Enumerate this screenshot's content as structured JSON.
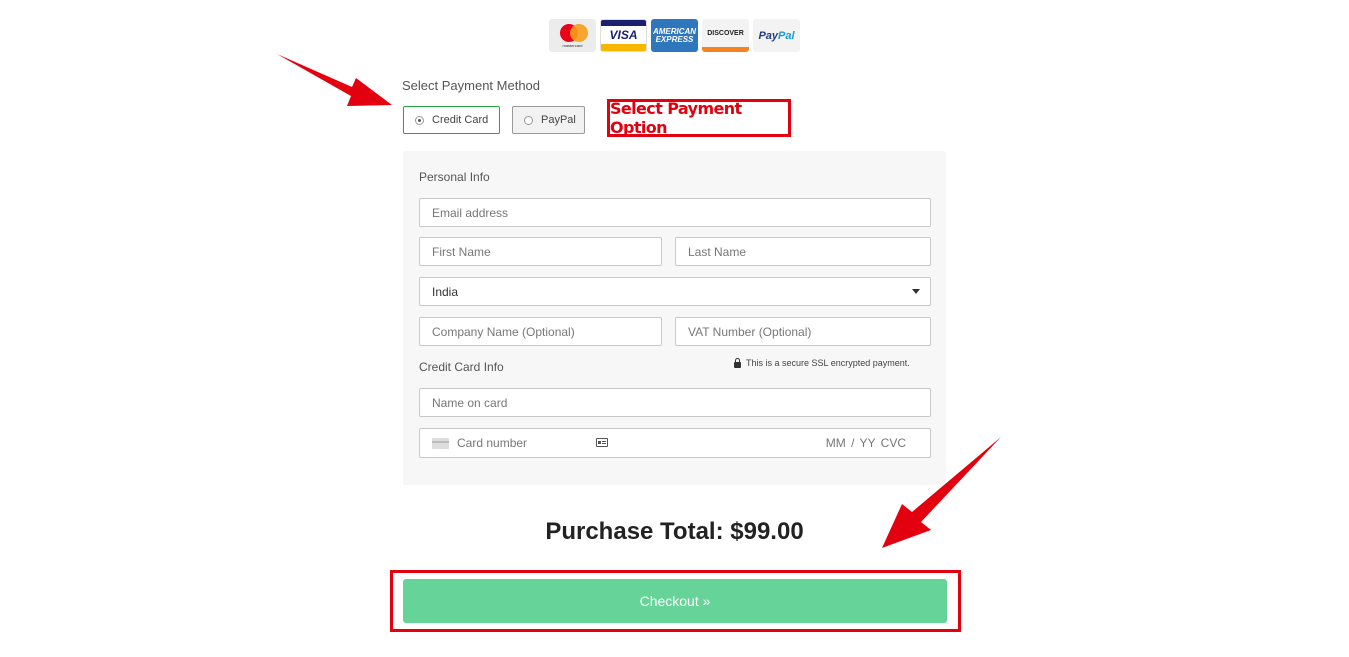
{
  "payment_logos": [
    {
      "name": "mastercard",
      "text": "mastercard"
    },
    {
      "name": "visa",
      "text": "VISA"
    },
    {
      "name": "american-express",
      "text_line1": "AMERICAN",
      "text_line2": "EXPRESS"
    },
    {
      "name": "discover",
      "text": "DISCOVER"
    },
    {
      "name": "paypal",
      "text_pay": "Pay",
      "text_pal": "Pal"
    }
  ],
  "payment_method": {
    "label": "Select Payment Method",
    "options": [
      {
        "label": "Credit Card",
        "selected": true
      },
      {
        "label": "PayPal",
        "selected": false
      }
    ]
  },
  "annotation": {
    "text": "Select Payment Option",
    "color": "#e3000f"
  },
  "personal_info": {
    "title": "Personal Info",
    "email_placeholder": "Email address",
    "first_name_placeholder": "First Name",
    "last_name_placeholder": "Last Name",
    "country_value": "India",
    "company_placeholder": "Company Name (Optional)",
    "vat_placeholder": "VAT Number (Optional)"
  },
  "credit_card_info": {
    "title": "Credit Card Info",
    "secure_note": "This is a secure SSL encrypted payment.",
    "name_on_card_placeholder": "Name on card",
    "card_number_placeholder": "Card number",
    "expiry_cvc_placeholder": "MM / YY  CVC"
  },
  "purchase_total": "Purchase Total: $99.00",
  "checkout": {
    "label": "Checkout »",
    "color": "#66d498"
  },
  "icons": [
    "lock-icon",
    "card-icon",
    "id-card-icon",
    "dropdown-caret-icon",
    "pointer-arrow-icon"
  ]
}
